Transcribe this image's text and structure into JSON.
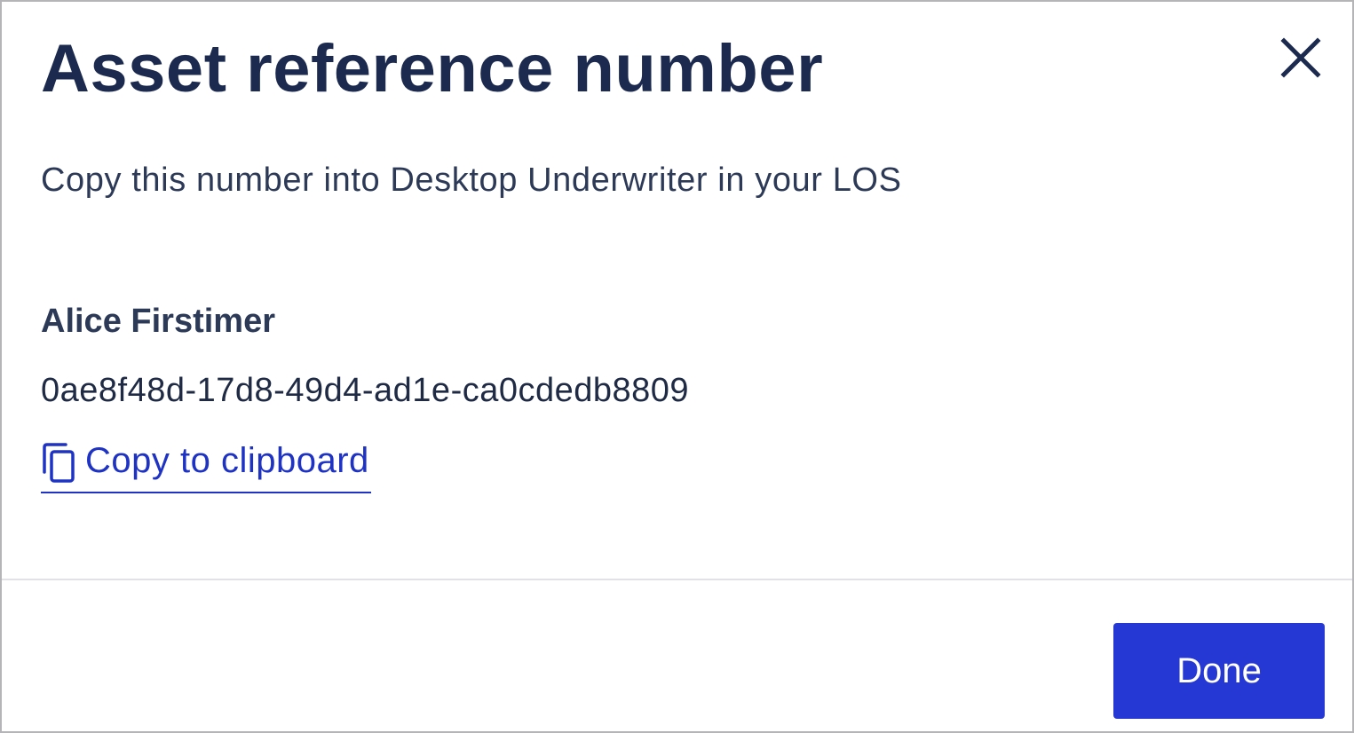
{
  "dialog": {
    "title": "Asset reference number",
    "close_icon": "close-icon",
    "subtitle": "Copy this number into Desktop Underwriter in your LOS",
    "borrower_name": "Alice Firstimer",
    "reference_number": "0ae8f48d-17d8-49d4-ad1e-ca0cdedb8809",
    "copy_link_label": "Copy to clipboard",
    "copy_icon": "copy-icon",
    "done_label": "Done"
  },
  "colors": {
    "title_text": "#1b2a4e",
    "body_text": "#2c3a58",
    "link": "#1e33c4",
    "primary_button": "#2538d4",
    "divider": "#e2e2e6",
    "border": "#b5b5b8"
  }
}
